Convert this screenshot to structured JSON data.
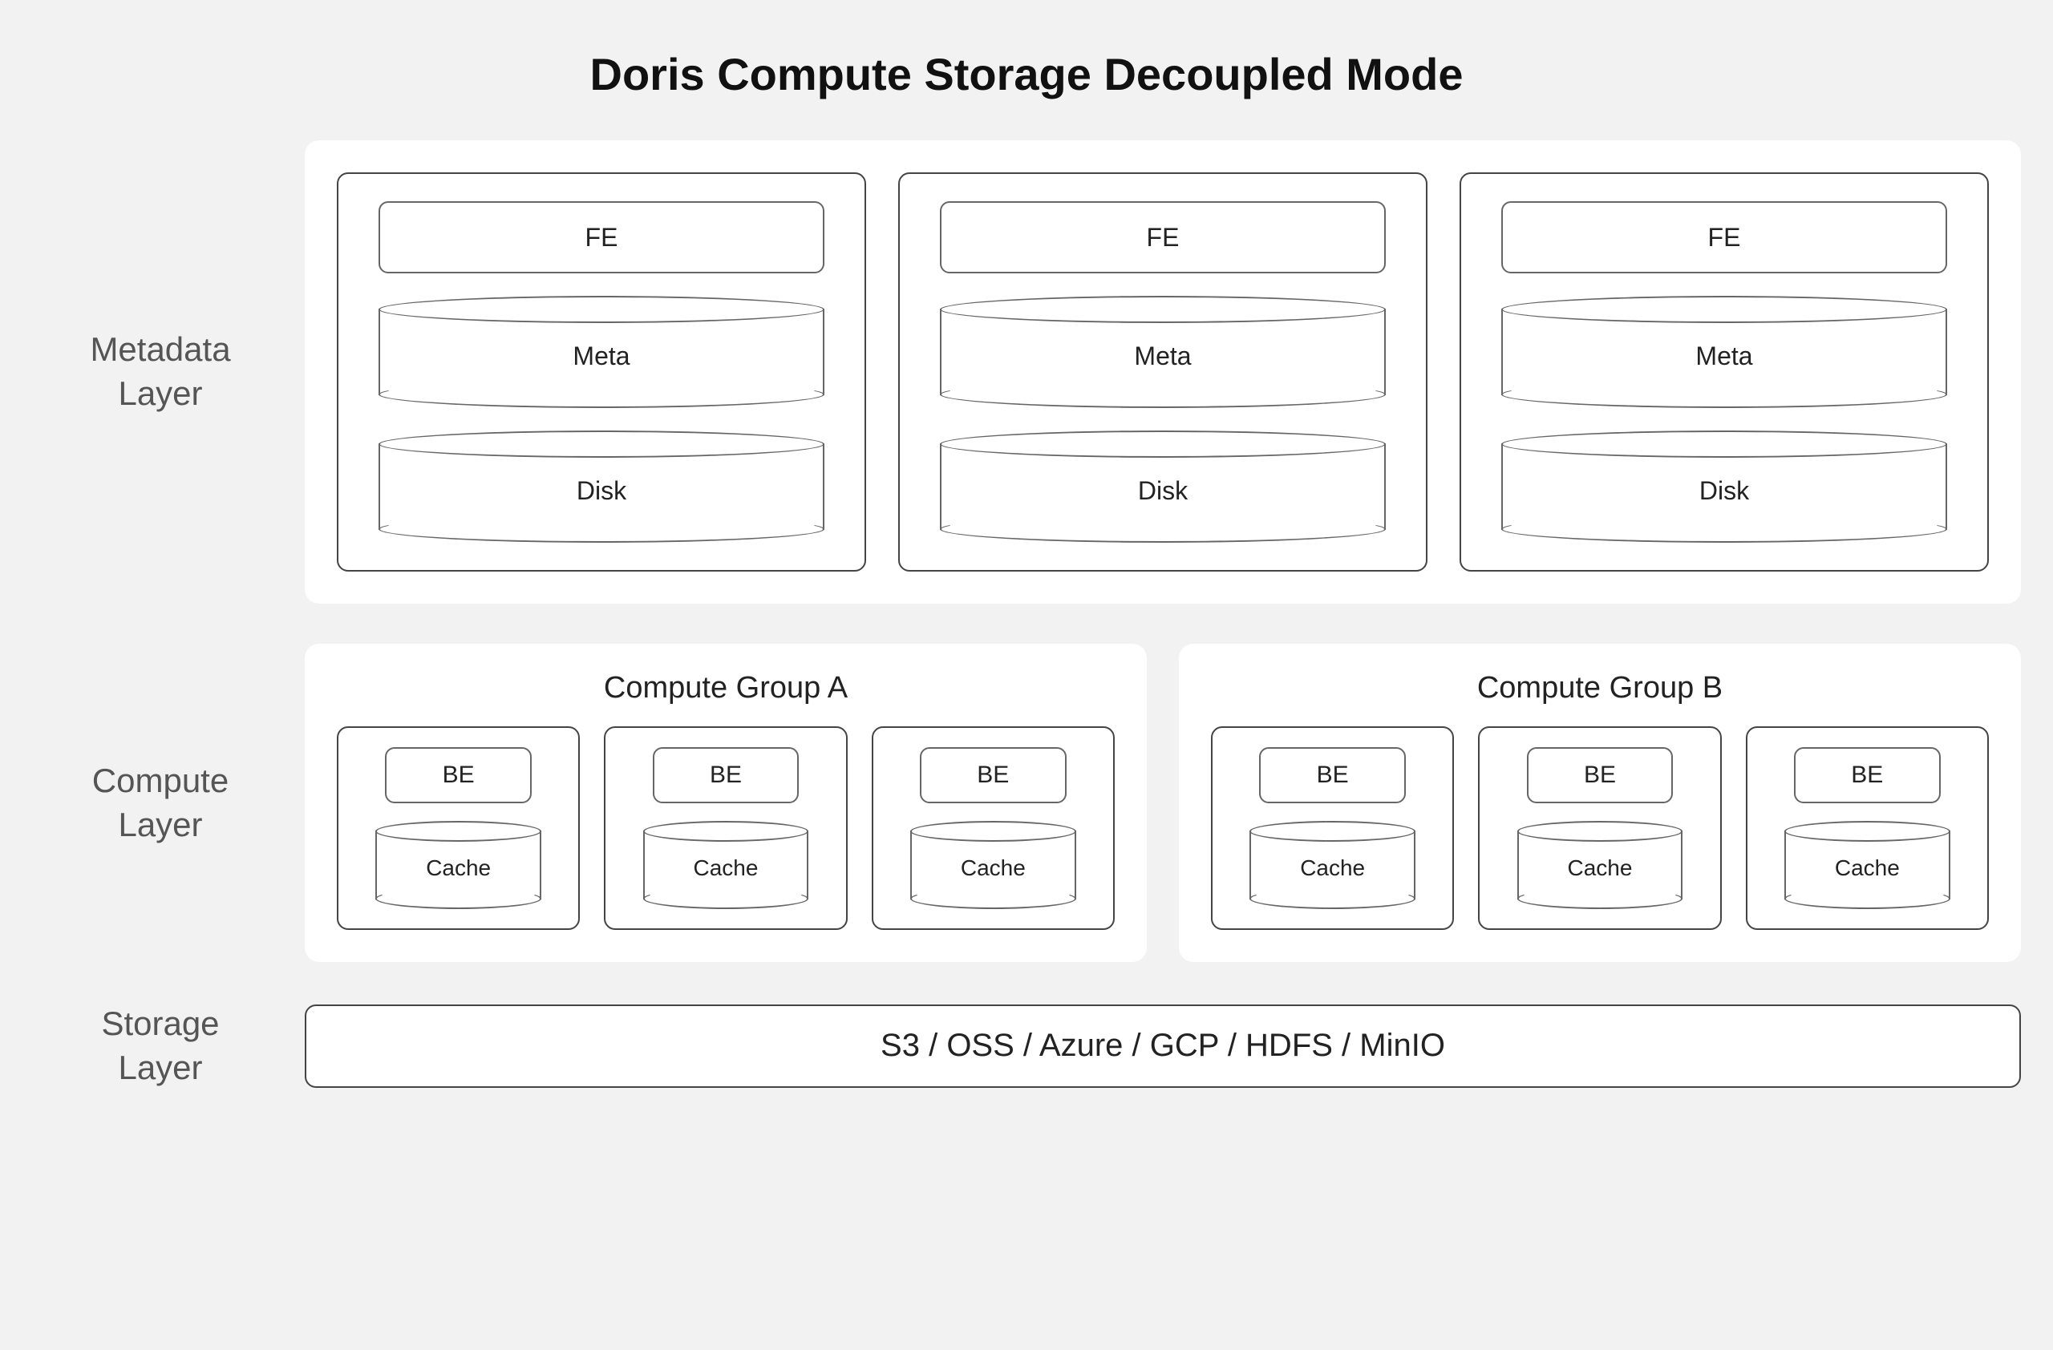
{
  "title": "Doris Compute Storage Decoupled Mode",
  "rows": {
    "metadata": {
      "label": "Metadata\nLayer",
      "nodes": [
        {
          "fe": "FE",
          "meta": "Meta",
          "disk": "Disk"
        },
        {
          "fe": "FE",
          "meta": "Meta",
          "disk": "Disk"
        },
        {
          "fe": "FE",
          "meta": "Meta",
          "disk": "Disk"
        }
      ]
    },
    "compute": {
      "label": "Compute\nLayer",
      "groups": [
        {
          "title": "Compute Group A",
          "nodes": [
            {
              "be": "BE",
              "cache": "Cache"
            },
            {
              "be": "BE",
              "cache": "Cache"
            },
            {
              "be": "BE",
              "cache": "Cache"
            }
          ]
        },
        {
          "title": "Compute Group B",
          "nodes": [
            {
              "be": "BE",
              "cache": "Cache"
            },
            {
              "be": "BE",
              "cache": "Cache"
            },
            {
              "be": "BE",
              "cache": "Cache"
            }
          ]
        }
      ]
    },
    "storage": {
      "label": "Storage\nLayer",
      "text": "S3 / OSS / Azure / GCP / HDFS / MinIO"
    }
  }
}
